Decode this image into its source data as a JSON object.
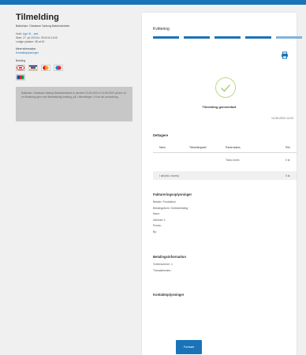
{
  "left": {
    "title": "Tilmelding",
    "event": "Bakkeløn: Gladsaxe Søborg Bakkeløntræe",
    "meta": [
      {
        "label": "Hold:",
        "value": "Uge 31 - test"
      },
      {
        "label": "Start:",
        "value": "27. jul 2023 kl. 09:00 til 14:00"
      },
      {
        "label": "Ledige pladser:",
        "value": "38 af 40"
      }
    ],
    "more_info_label": "Mere information",
    "more_info_link": "Kontaktoplysninger",
    "payment_label": "Betaling",
    "notice": "Bakkeløn: Gladsaxe Søborg Bakkeløntræne er ændret 13.08.2023 kl 14:08 2023 på den af en tilmelding igen med tilstrækkelig betaling, på 1 tilmeldinger. Vi har din anmodning"
  },
  "right": {
    "section_title": "Kvittering",
    "done_text": "Tilmelding gennemført",
    "date": "14.05.2023 14:23",
    "participants_title": "Deltagere",
    "table_headers": [
      "Navn",
      "Tilmeldingsdel",
      "Pasta status",
      "Pris"
    ],
    "row_values": {
      "name": "Tiara Jones",
      "price": "0 kr."
    },
    "total_label": "I alt (inkl. moms)",
    "total_value": "0 kr.",
    "invoice_title": "Faktureringsoplysninger",
    "invoice_lines": [
      "Betaler: Produktion",
      "Betalingsform: Onlinebetaling",
      "Navn:",
      "Adresse 1:",
      "Postnr.:",
      "By:"
    ],
    "payment_info_title": "Betalingsinformation",
    "payment_info_lines": [
      "Ordrenummer: 1",
      "Transaktionsnr.:"
    ],
    "contact_title": "Kontaktoplysninger",
    "continue_button": "Fortsæt"
  },
  "colors": {
    "accent": "#1a73b8",
    "accent_light": "#7fb3dc",
    "notice_bg": "#c7c7c7",
    "check": "#9ccc65"
  },
  "icons": [
    "printer-icon",
    "checkmark-icon",
    "dankort-icon",
    "visa-icon",
    "mastercard-icon",
    "maestro-icon",
    "jcb-icon"
  ]
}
